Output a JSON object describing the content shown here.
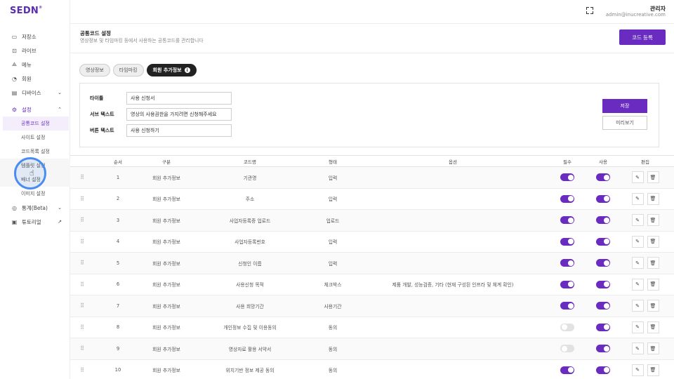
{
  "app": {
    "logo": "SEDN",
    "logo_mark": "®"
  },
  "sidebar": {
    "items": [
      {
        "label": "저장소",
        "icon": "storage-icon"
      },
      {
        "label": "라이브",
        "icon": "live-icon"
      },
      {
        "label": "메뉴",
        "icon": "menu-icon"
      },
      {
        "label": "회원",
        "icon": "user-icon"
      },
      {
        "label": "디바이스",
        "icon": "device-icon"
      },
      {
        "label": "설정",
        "icon": "settings-icon"
      }
    ],
    "settings_sub": [
      {
        "label": "공통코드 설정"
      },
      {
        "label": "사이트 설정"
      },
      {
        "label": "코드목록 설정"
      },
      {
        "label": "템플릿 설정"
      },
      {
        "label": "배너 설정"
      },
      {
        "label": "이미지 설정"
      }
    ],
    "bottom_items": [
      {
        "label": "통계(Beta)",
        "icon": "stats-icon"
      },
      {
        "label": "튜토리얼",
        "icon": "tutorial-icon"
      }
    ]
  },
  "header": {
    "user_name": "관리자",
    "user_email": "admin@inucreative.com"
  },
  "page": {
    "title": "공통코드 설정",
    "description": "영상정보 및 타임마킹 등에서 사용하는 공통코드를 관리합니다",
    "register_label": "코드 등록"
  },
  "tabs": [
    {
      "label": "영상정보"
    },
    {
      "label": "타임마킹"
    },
    {
      "label": "회원 추가정보"
    }
  ],
  "form": {
    "title_label": "타이틀",
    "title_value": "사용 신청서",
    "subtext_label": "서브 텍스트",
    "subtext_value": "영상의 사용권한을 가지려면 신청해주세요",
    "button_label": "버튼 텍스트",
    "button_value": "사용 신청하기",
    "save_label": "저장",
    "preview_label": "미리보기"
  },
  "table": {
    "headers": [
      "순서",
      "구분",
      "코드명",
      "형태",
      "옵션",
      "필수",
      "사용",
      "편집"
    ],
    "rows": [
      {
        "order": "1",
        "category": "회원 추가정보",
        "name": "기관명",
        "type": "입력",
        "option": "",
        "required": true,
        "use": true
      },
      {
        "order": "2",
        "category": "회원 추가정보",
        "name": "주소",
        "type": "입력",
        "option": "",
        "required": true,
        "use": true
      },
      {
        "order": "3",
        "category": "회원 추가정보",
        "name": "사업자등록증 업로드",
        "type": "업로드",
        "option": "",
        "required": true,
        "use": true
      },
      {
        "order": "4",
        "category": "회원 추가정보",
        "name": "사업자등록번호",
        "type": "입력",
        "option": "",
        "required": true,
        "use": true
      },
      {
        "order": "5",
        "category": "회원 추가정보",
        "name": "신청인 이름",
        "type": "입력",
        "option": "",
        "required": true,
        "use": true
      },
      {
        "order": "6",
        "category": "회원 추가정보",
        "name": "사용신청 목적",
        "type": "체크박스",
        "option": "제품 개발, 성능검증, 기타 (현재 구성된 인프라 및 체계 확인)",
        "required": true,
        "use": true
      },
      {
        "order": "7",
        "category": "회원 추가정보",
        "name": "사용 희망기간",
        "type": "사용기간",
        "option": "",
        "required": true,
        "use": true
      },
      {
        "order": "8",
        "category": "회원 추가정보",
        "name": "개인정보 수집 및 이용동의",
        "type": "동의",
        "option": "",
        "required": false,
        "use": true
      },
      {
        "order": "9",
        "category": "회원 추가정보",
        "name": "영상자료 활용 서약서",
        "type": "동의",
        "option": "",
        "required": false,
        "use": true
      },
      {
        "order": "10",
        "category": "회원 추가정보",
        "name": "위치기반 정보 제공 동의",
        "type": "동의",
        "option": "",
        "required": true,
        "use": true
      }
    ]
  },
  "colors": {
    "accent": "#6a2bc0",
    "cursor": "#4a8df0"
  }
}
